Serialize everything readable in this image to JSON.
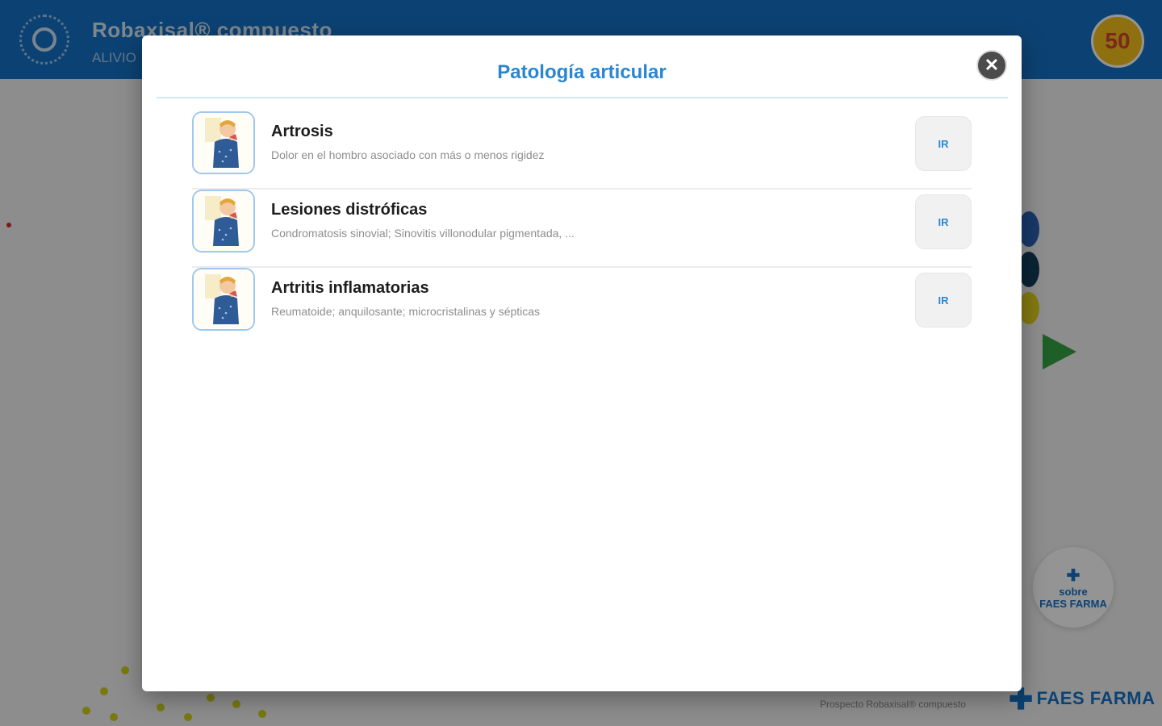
{
  "app": {
    "title": "Robaxisal® compuesto",
    "subtitle": "ALIVIO",
    "badge": "50",
    "about": {
      "line1": "sobre",
      "line2": "FAES FARMA"
    },
    "brand": "FAES FARMA",
    "prospect_link": "Prospecto Robaxisal® compuesto"
  },
  "modal": {
    "title": "Patología articular",
    "close_icon": "close-icon",
    "items": [
      {
        "title": "Artrosis",
        "description": "Dolor en el hombro asociado con más o menos rigidez",
        "button_label": "IR",
        "icon": "shoulder-pain-icon"
      },
      {
        "title": "Lesiones distróficas",
        "description": "Condromatosis sinovial; Sinovitis villonodular pigmentada, ...",
        "button_label": "IR",
        "icon": "shoulder-pain-icon"
      },
      {
        "title": "Artritis inflamatorias",
        "description": "Reumatoide; anquilosante; microcristalinas y sépticas",
        "button_label": "IR",
        "icon": "shoulder-pain-icon"
      }
    ]
  },
  "colors": {
    "header_blue": "#1673c7",
    "accent_blue": "#2b86d1",
    "overlay": "rgba(0,0,0,0.42)"
  }
}
